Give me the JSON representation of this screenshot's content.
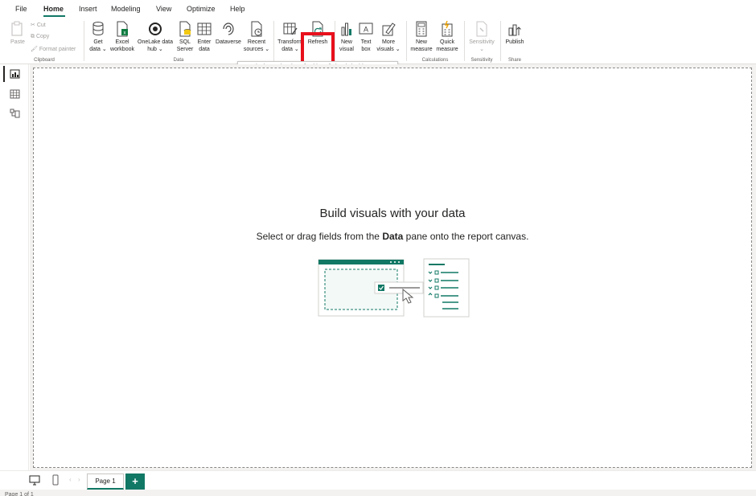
{
  "menu": {
    "tabs": [
      {
        "label": "File"
      },
      {
        "label": "Home"
      },
      {
        "label": "Insert"
      },
      {
        "label": "Modeling"
      },
      {
        "label": "View"
      },
      {
        "label": "Optimize"
      },
      {
        "label": "Help"
      }
    ],
    "active_tab": "Home"
  },
  "ribbon": {
    "clipboard": {
      "paste": "Paste",
      "cut": "Cut",
      "copy": "Copy",
      "format_painter": "Format painter",
      "group_label": "Clipboard"
    },
    "data": {
      "get_data": [
        "Get",
        "data ⌄"
      ],
      "excel": [
        "Excel",
        "workbook"
      ],
      "onelake": [
        "OneLake data",
        "hub ⌄"
      ],
      "sql": [
        "SQL",
        "Server"
      ],
      "enter_data": [
        "Enter",
        "data"
      ],
      "dataverse": [
        "Dataverse"
      ],
      "recent": [
        "Recent",
        "sources ⌄"
      ],
      "group_label": "Data"
    },
    "queries": {
      "transform": [
        "Transform",
        "data ⌄"
      ],
      "refresh": [
        "Refresh"
      ]
    },
    "insert": {
      "new_visual": [
        "New",
        "visual"
      ],
      "text_box": [
        "Text",
        "box"
      ],
      "more_visuals": [
        "More",
        "visuals ⌄"
      ]
    },
    "calculations": {
      "new_measure": [
        "New",
        "measure"
      ],
      "quick_measure": [
        "Quick",
        "measure"
      ],
      "group_label": "Calculations"
    },
    "sensitivity": {
      "label": [
        "Sensitivity",
        "⌄"
      ],
      "group_label": "Sensitivity"
    },
    "share": {
      "publish": [
        "Publish"
      ],
      "group_label": "Share"
    }
  },
  "tooltip": "Get the latest data by refreshing all visuals in this report.",
  "canvas": {
    "title": "Build visuals with your data",
    "subtitle_before": "Select or drag fields from the ",
    "subtitle_bold": "Data",
    "subtitle_after": " pane onto the report canvas."
  },
  "pages": {
    "tabs": [
      "Page 1"
    ],
    "add": "+",
    "status": "Page 1 of 1"
  },
  "colors": {
    "accent": "#117865",
    "highlight": "#e8101c"
  }
}
